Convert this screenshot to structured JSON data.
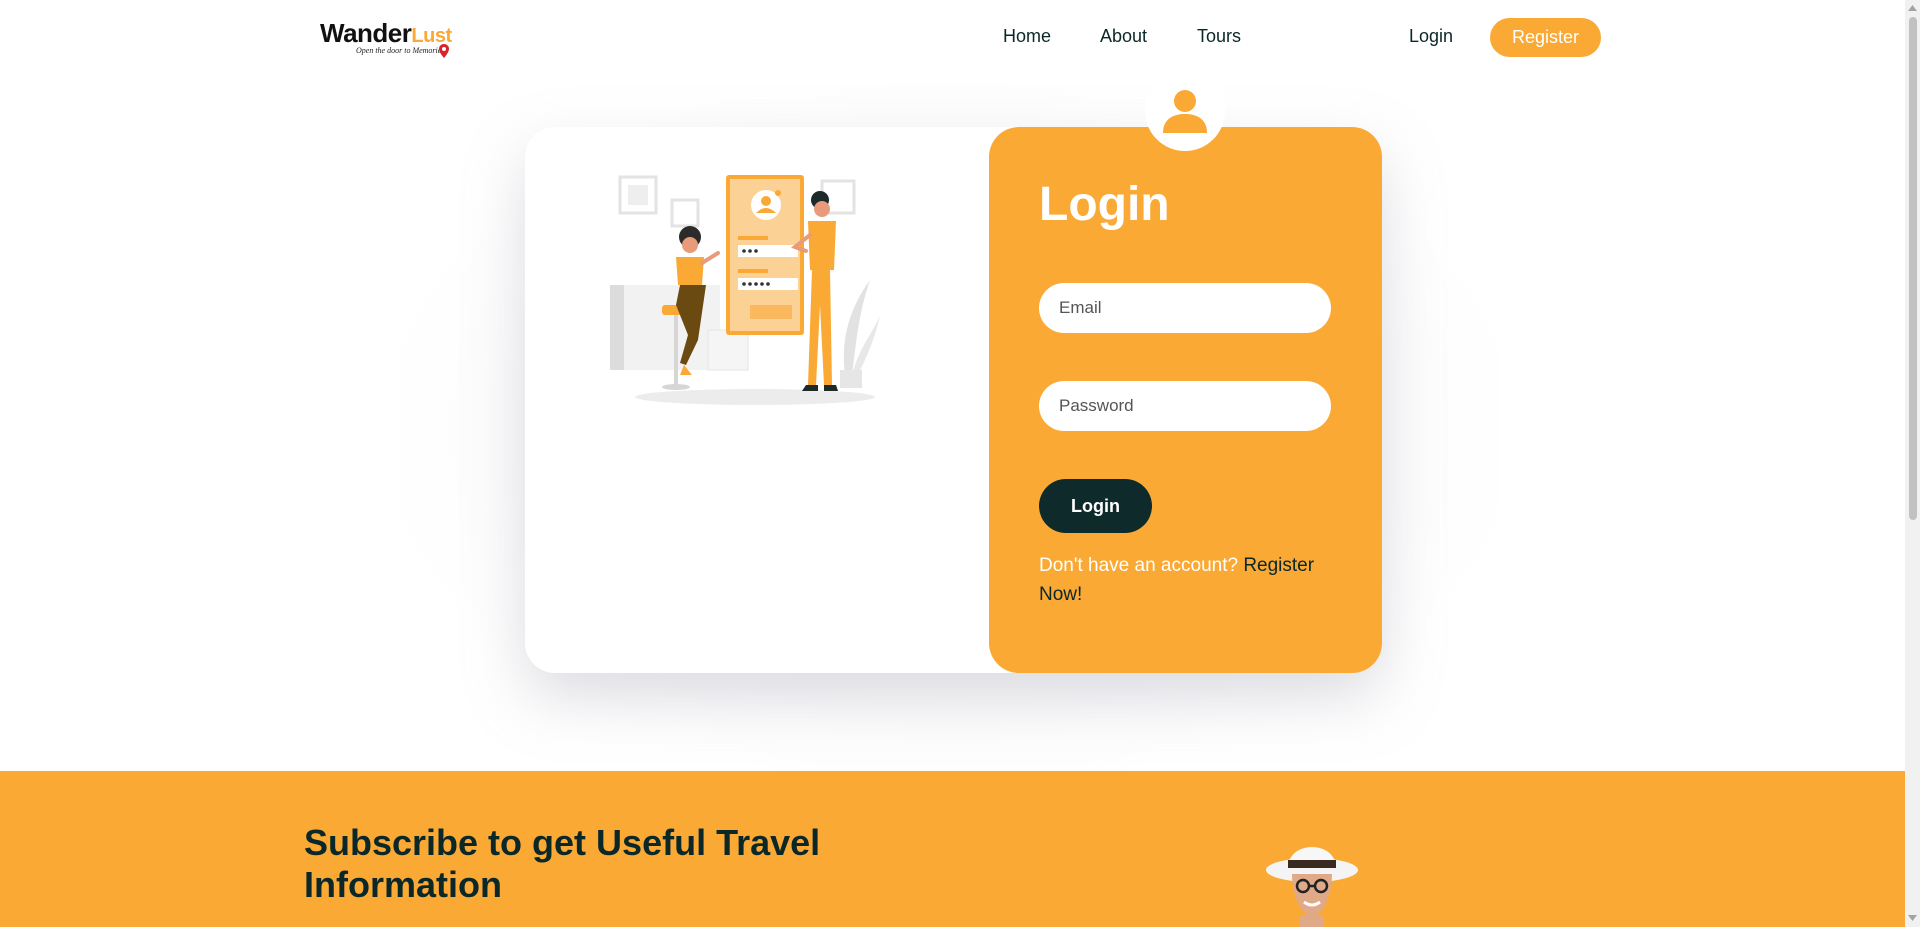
{
  "header": {
    "logo": {
      "brand_main": "Wander",
      "brand_accent": "Lust",
      "tagline": "Open the door to Memories"
    },
    "nav": {
      "home": "Home",
      "about": "About",
      "tours": "Tours"
    },
    "login_label": "Login",
    "register_label": "Register"
  },
  "login_form": {
    "title": "Login",
    "email_placeholder": "Email",
    "password_placeholder": "Password",
    "submit_label": "Login",
    "signup_prompt": "Don't have an account? ",
    "signup_link": "Register Now!"
  },
  "subscribe": {
    "title": "Subscribe to get Useful Travel Information"
  },
  "colors": {
    "accent": "#faa935",
    "dark": "#0f2a2a",
    "background": "#ffffff"
  },
  "icons": {
    "user_avatar": "user-icon",
    "logo_pin": "location-pin-icon",
    "scroll_up": "triangle-up-icon",
    "scroll_down": "triangle-down-icon"
  }
}
